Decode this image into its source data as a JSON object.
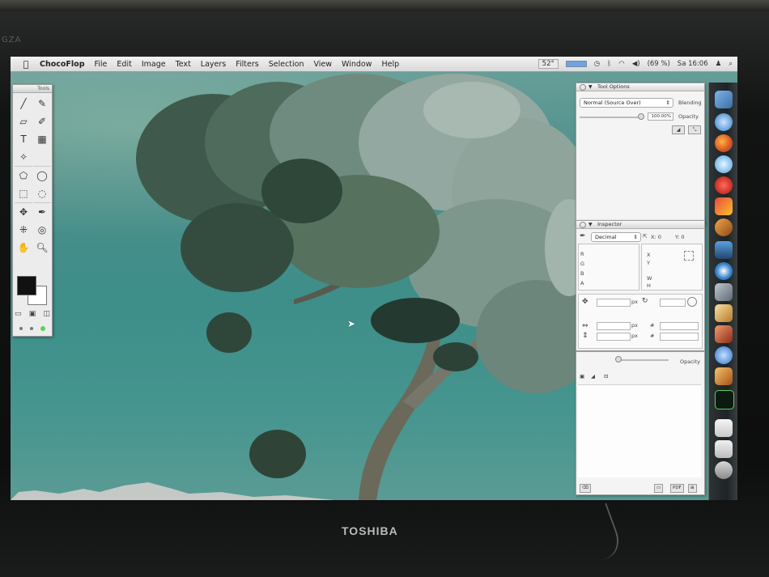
{
  "monitor": {
    "brand": "TOSHIBA",
    "corner_brand": "GZA"
  },
  "menubar": {
    "app_name": "ChocoFlop",
    "menus": [
      "File",
      "Edit",
      "Image",
      "Text",
      "Layers",
      "Filters",
      "Selection",
      "View",
      "Window",
      "Help"
    ],
    "temperature": "52°",
    "battery": "(69 %)",
    "clock": "Sa 16:06"
  },
  "tools_palette": {
    "title": "Tools"
  },
  "tool_options": {
    "title": "Tool Options",
    "blend_mode": "Normal (Source Over)",
    "blending_label": "Blending",
    "opacity_value": "100.00%",
    "opacity_label": "Opacity"
  },
  "inspector": {
    "title": "Inspector",
    "units": "Decimal",
    "x_readout": "X: 0",
    "y_readout": "Y: 0",
    "channels": [
      "R",
      "G",
      "B",
      "A"
    ],
    "geometry": [
      "X",
      "Y",
      "W",
      "H"
    ],
    "unit_px": "px",
    "hash": "#"
  },
  "layers": {
    "opacity_label": "Opacity",
    "buttons": [
      "PDF"
    ]
  },
  "colors": {
    "water": "#3d8e89",
    "accent_green": "#5bd05b"
  }
}
